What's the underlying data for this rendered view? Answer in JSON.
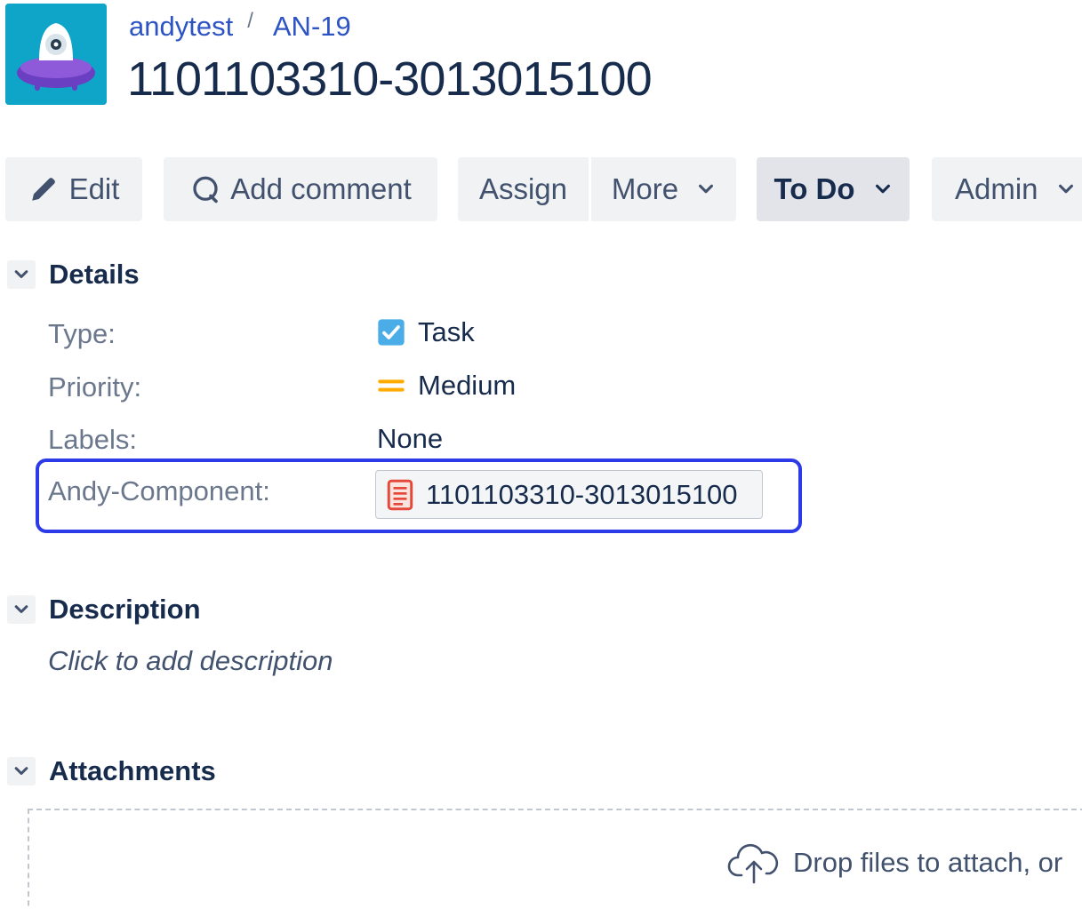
{
  "header": {
    "avatar_icon": "project-robot-avatar-icon",
    "breadcrumb": {
      "project": "andytest",
      "separator": "/",
      "issue_key": "AN-19"
    },
    "title": "1101103310-3013015100"
  },
  "toolbar": {
    "edit": {
      "label": "Edit",
      "icon": "pencil-icon"
    },
    "add_comment": {
      "label": "Add comment",
      "icon": "comment-icon"
    },
    "assign": {
      "label": "Assign"
    },
    "more": {
      "label": "More",
      "icon": "chevron-down-icon"
    },
    "status": {
      "label": "To Do",
      "icon": "chevron-down-icon"
    },
    "admin": {
      "label": "Admin",
      "icon": "chevron-down-icon"
    }
  },
  "details": {
    "title": "Details",
    "fields": {
      "type": {
        "label": "Type:",
        "value": "Task",
        "icon": "task-checkbox-icon",
        "icon_color": "#4bade8"
      },
      "priority": {
        "label": "Priority:",
        "value": "Medium",
        "icon": "priority-medium-icon",
        "icon_color": "#ffab00"
      },
      "labels": {
        "label": "Labels:",
        "value": "None"
      },
      "component": {
        "label": "Andy-Component:",
        "value": "1101103310-3013015100",
        "icon": "document-icon",
        "icon_color": "#e5493a"
      }
    },
    "highlight_color": "#2c3ae8"
  },
  "description": {
    "title": "Description",
    "placeholder": "Click to add description"
  },
  "attachments": {
    "title": "Attachments",
    "drop_text": "Drop files to attach, or",
    "icon": "cloud-upload-icon"
  }
}
